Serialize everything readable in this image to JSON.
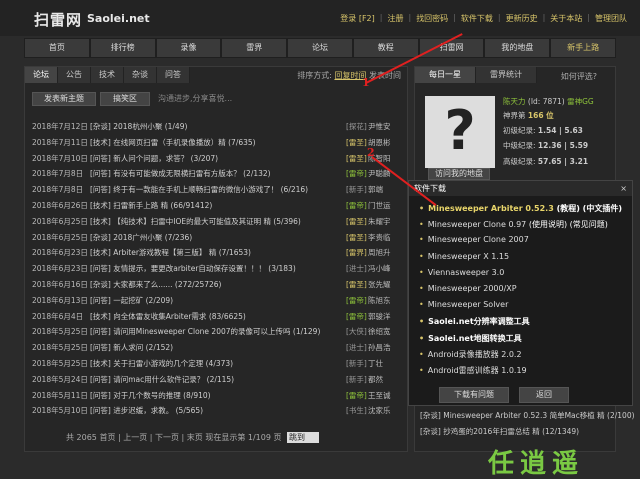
{
  "header": {
    "logo": "扫雷网",
    "logo_sub": "Saolei.net",
    "links": [
      "登录 [F2]",
      "注册",
      "找回密码",
      "软件下载",
      "更新历史",
      "关于本站",
      "管理团队"
    ]
  },
  "nav": [
    "首页",
    "排行榜",
    "录像",
    "雷界",
    "论坛",
    "教程",
    "扫雷网",
    "我的地盘",
    "新手上路"
  ],
  "forum": {
    "tabs": [
      "论坛",
      "公告",
      "技术",
      "杂谈",
      "问答"
    ],
    "sort_label": "排序方式:",
    "sort_active": "回复时间",
    "sort_other": "发表时间",
    "new_post_button": "发表新主题",
    "search_button": "搞笑区",
    "placeholder": "沟通进步,分享喜悦...",
    "rows": [
      {
        "date": "2018年7月12日",
        "title": "[杂谈] 2018杭州小聚 (1/49)",
        "cat": "[探花]",
        "author": "尹惟安"
      },
      {
        "date": "2018年7月11日",
        "title": "[技术] 在线网页扫雷（手机录像播放）精 (7/635)",
        "cat": "[雷圣]",
        "author": "胡恩彬"
      },
      {
        "date": "2018年7月10日",
        "title": "[问答] 新人问个问题，求答？ (3/207)",
        "cat": "[雷圣]",
        "author": "陈智阳"
      },
      {
        "date": "2018年7月8日",
        "title": "[问答] 有没有可能做成无限横扫雷有方版本？ (2/132)",
        "cat": "[雷帝]",
        "author": "尹聪麟"
      },
      {
        "date": "2018年7月8日",
        "title": "[问答] 终于有一款能在手机上顺畅扫雷的微信小游戏了！ (6/216)",
        "cat": "[新手]",
        "author": "郭端"
      },
      {
        "date": "2018年6月26日",
        "title": "[技术] 扫雷新手上路 精 (66/91412)",
        "cat": "[雷帝]",
        "author": "门世运"
      },
      {
        "date": "2018年6月25日",
        "title": "[技术] 【纯技术】扫雷中IOE的最大可能值及其证明 精 (5/396)",
        "cat": "[雷圣]",
        "author": "朱耀宇"
      },
      {
        "date": "2018年6月25日",
        "title": "[杂谈] 2018广州小聚 (7/236)",
        "cat": "[雷圣]",
        "author": "李贵临"
      },
      {
        "date": "2018年6月23日",
        "title": "[技术] Arbiter游戏教程【第三版】 精 (7/1653)",
        "cat": "[雷界]",
        "author": "周旭升"
      },
      {
        "date": "2018年6月23日",
        "title": "[问答] 友情提示，要更改arbiter自动保存设置！！！ (3/183)",
        "cat": "[进士]",
        "author": "冯小峰"
      },
      {
        "date": "2018年6月16日",
        "title": "[杂谈] 大家都来了么...... (272/25726)",
        "cat": "[雷圣]",
        "author": "张先耀"
      },
      {
        "date": "2018年6月13日",
        "title": "[问答] 一起挖矿 (2/209)",
        "cat": "[雷帝]",
        "author": "陈旭东"
      },
      {
        "date": "2018年6月4日",
        "title": "[技术] 向全体雷友收集Arbiter需求 (83/6625)",
        "cat": "[雷帝]",
        "author": "郭骏洋"
      },
      {
        "date": "2018年5月25日",
        "title": "[问答] 请问用Minesweeper Clone 2007的录像可以上传吗 (1/129)",
        "cat": "[大侠]",
        "author": "徐绍宽"
      },
      {
        "date": "2018年5月25日",
        "title": "[问答] 新人求问 (2/152)",
        "cat": "[进士]",
        "author": "孙昌浩"
      },
      {
        "date": "2018年5月25日",
        "title": "[技术] 关于扫雷小游戏的几个定理 (4/373)",
        "cat": "[新手]",
        "author": "丁壮"
      },
      {
        "date": "2018年5月24日",
        "title": "[问答] 请问mac用什么软件记录？ (2/115)",
        "cat": "[新手]",
        "author": "都然"
      },
      {
        "date": "2018年5月11日",
        "title": "[问答] 对于几个数号的推理 (8/910)",
        "cat": "[雷帝]",
        "author": "王至诚"
      },
      {
        "date": "2018年5月10日",
        "title": "[问答] 进步迟缓，求教。 (5/565)",
        "cat": "[书生]",
        "author": "沈家乐"
      }
    ],
    "pager": "共 2065 首页 | 上一页 | 下一页 | 末页 现在显示第 1/109 页",
    "jump": "跳到"
  },
  "sidebar": {
    "tabs": [
      "每日一星",
      "雷界统计"
    ],
    "question_link": "如何评选?",
    "player": {
      "name": "陈天力",
      "id": "(Id: 7871)",
      "rank": "雷神GG"
    },
    "stats": [
      {
        "label": "神界第",
        "value": "166 位"
      },
      {
        "label": "初级纪录:",
        "value": "1.54 | 5.63"
      },
      {
        "label": "中级纪录:",
        "value": "12.36 | 5.59"
      },
      {
        "label": "高级纪录:",
        "value": "57.65 | 3.21"
      }
    ],
    "visit_button": "访问我的地盘",
    "bottom_rows": [
      "[杂谈] Minesweeper Arbiter 0.52.3 简单Mac移植 精 (2/100)",
      "[杂谈] 抄鸡蛋的2016年扫雷总结 精 (12/1349)"
    ]
  },
  "dialog": {
    "title": "软件下载",
    "close": "×",
    "items": [
      {
        "name": "Minesweeper Arbiter 0.52.3",
        "note": "(教程) (中文插件)",
        "bold": true,
        "yellow": true
      },
      {
        "name": "Minesweeper Clone 0.97",
        "note": "(使用说明) (常见问题)",
        "bold": false,
        "yellow": false
      },
      {
        "name": "Minesweeper Clone 2007",
        "note": "",
        "bold": false,
        "yellow": false
      },
      {
        "name": "Minesweeper X 1.15",
        "note": "",
        "bold": false,
        "yellow": false
      },
      {
        "name": "Viennasweeper 3.0",
        "note": "",
        "bold": false,
        "yellow": false
      },
      {
        "name": "Minesweeper 2000/XP",
        "note": "",
        "bold": false,
        "yellow": false
      },
      {
        "name": "Minesweeper Solver",
        "note": "",
        "bold": false,
        "yellow": false
      },
      {
        "name": "Saolei.net分辨率调整工具",
        "note": "",
        "bold": true,
        "yellow": false
      },
      {
        "name": "Saolei.net地图转换工具",
        "note": "",
        "bold": true,
        "yellow": false
      },
      {
        "name": "Android录像播放器 2.0.2",
        "note": "",
        "bold": false,
        "yellow": false
      },
      {
        "name": "Android雷感训练器 1.0.19",
        "note": "",
        "bold": false,
        "yellow": false
      }
    ],
    "buttons": [
      "下载有问题",
      "返回"
    ]
  },
  "annotations": [
    "1",
    "2"
  ],
  "watermark": "任逍遥"
}
